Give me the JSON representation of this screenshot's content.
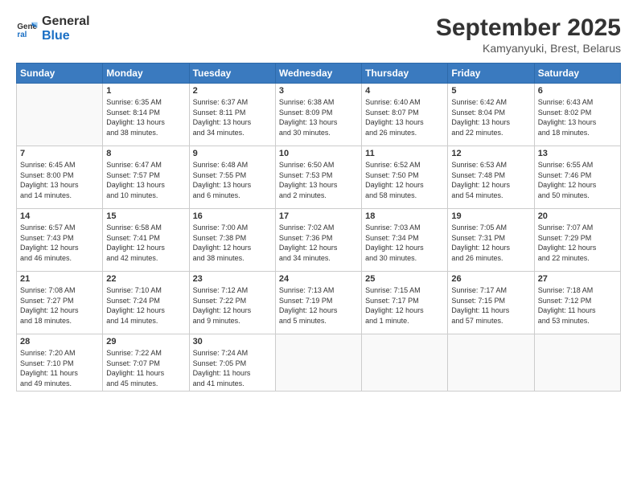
{
  "header": {
    "logo_line1": "General",
    "logo_line2": "Blue",
    "month": "September 2025",
    "location": "Kamyanyuki, Brest, Belarus"
  },
  "weekdays": [
    "Sunday",
    "Monday",
    "Tuesday",
    "Wednesday",
    "Thursday",
    "Friday",
    "Saturday"
  ],
  "weeks": [
    [
      {
        "day": "",
        "info": ""
      },
      {
        "day": "1",
        "info": "Sunrise: 6:35 AM\nSunset: 8:14 PM\nDaylight: 13 hours\nand 38 minutes."
      },
      {
        "day": "2",
        "info": "Sunrise: 6:37 AM\nSunset: 8:11 PM\nDaylight: 13 hours\nand 34 minutes."
      },
      {
        "day": "3",
        "info": "Sunrise: 6:38 AM\nSunset: 8:09 PM\nDaylight: 13 hours\nand 30 minutes."
      },
      {
        "day": "4",
        "info": "Sunrise: 6:40 AM\nSunset: 8:07 PM\nDaylight: 13 hours\nand 26 minutes."
      },
      {
        "day": "5",
        "info": "Sunrise: 6:42 AM\nSunset: 8:04 PM\nDaylight: 13 hours\nand 22 minutes."
      },
      {
        "day": "6",
        "info": "Sunrise: 6:43 AM\nSunset: 8:02 PM\nDaylight: 13 hours\nand 18 minutes."
      }
    ],
    [
      {
        "day": "7",
        "info": "Sunrise: 6:45 AM\nSunset: 8:00 PM\nDaylight: 13 hours\nand 14 minutes."
      },
      {
        "day": "8",
        "info": "Sunrise: 6:47 AM\nSunset: 7:57 PM\nDaylight: 13 hours\nand 10 minutes."
      },
      {
        "day": "9",
        "info": "Sunrise: 6:48 AM\nSunset: 7:55 PM\nDaylight: 13 hours\nand 6 minutes."
      },
      {
        "day": "10",
        "info": "Sunrise: 6:50 AM\nSunset: 7:53 PM\nDaylight: 13 hours\nand 2 minutes."
      },
      {
        "day": "11",
        "info": "Sunrise: 6:52 AM\nSunset: 7:50 PM\nDaylight: 12 hours\nand 58 minutes."
      },
      {
        "day": "12",
        "info": "Sunrise: 6:53 AM\nSunset: 7:48 PM\nDaylight: 12 hours\nand 54 minutes."
      },
      {
        "day": "13",
        "info": "Sunrise: 6:55 AM\nSunset: 7:46 PM\nDaylight: 12 hours\nand 50 minutes."
      }
    ],
    [
      {
        "day": "14",
        "info": "Sunrise: 6:57 AM\nSunset: 7:43 PM\nDaylight: 12 hours\nand 46 minutes."
      },
      {
        "day": "15",
        "info": "Sunrise: 6:58 AM\nSunset: 7:41 PM\nDaylight: 12 hours\nand 42 minutes."
      },
      {
        "day": "16",
        "info": "Sunrise: 7:00 AM\nSunset: 7:38 PM\nDaylight: 12 hours\nand 38 minutes."
      },
      {
        "day": "17",
        "info": "Sunrise: 7:02 AM\nSunset: 7:36 PM\nDaylight: 12 hours\nand 34 minutes."
      },
      {
        "day": "18",
        "info": "Sunrise: 7:03 AM\nSunset: 7:34 PM\nDaylight: 12 hours\nand 30 minutes."
      },
      {
        "day": "19",
        "info": "Sunrise: 7:05 AM\nSunset: 7:31 PM\nDaylight: 12 hours\nand 26 minutes."
      },
      {
        "day": "20",
        "info": "Sunrise: 7:07 AM\nSunset: 7:29 PM\nDaylight: 12 hours\nand 22 minutes."
      }
    ],
    [
      {
        "day": "21",
        "info": "Sunrise: 7:08 AM\nSunset: 7:27 PM\nDaylight: 12 hours\nand 18 minutes."
      },
      {
        "day": "22",
        "info": "Sunrise: 7:10 AM\nSunset: 7:24 PM\nDaylight: 12 hours\nand 14 minutes."
      },
      {
        "day": "23",
        "info": "Sunrise: 7:12 AM\nSunset: 7:22 PM\nDaylight: 12 hours\nand 9 minutes."
      },
      {
        "day": "24",
        "info": "Sunrise: 7:13 AM\nSunset: 7:19 PM\nDaylight: 12 hours\nand 5 minutes."
      },
      {
        "day": "25",
        "info": "Sunrise: 7:15 AM\nSunset: 7:17 PM\nDaylight: 12 hours\nand 1 minute."
      },
      {
        "day": "26",
        "info": "Sunrise: 7:17 AM\nSunset: 7:15 PM\nDaylight: 11 hours\nand 57 minutes."
      },
      {
        "day": "27",
        "info": "Sunrise: 7:18 AM\nSunset: 7:12 PM\nDaylight: 11 hours\nand 53 minutes."
      }
    ],
    [
      {
        "day": "28",
        "info": "Sunrise: 7:20 AM\nSunset: 7:10 PM\nDaylight: 11 hours\nand 49 minutes."
      },
      {
        "day": "29",
        "info": "Sunrise: 7:22 AM\nSunset: 7:07 PM\nDaylight: 11 hours\nand 45 minutes."
      },
      {
        "day": "30",
        "info": "Sunrise: 7:24 AM\nSunset: 7:05 PM\nDaylight: 11 hours\nand 41 minutes."
      },
      {
        "day": "",
        "info": ""
      },
      {
        "day": "",
        "info": ""
      },
      {
        "day": "",
        "info": ""
      },
      {
        "day": "",
        "info": ""
      }
    ]
  ]
}
